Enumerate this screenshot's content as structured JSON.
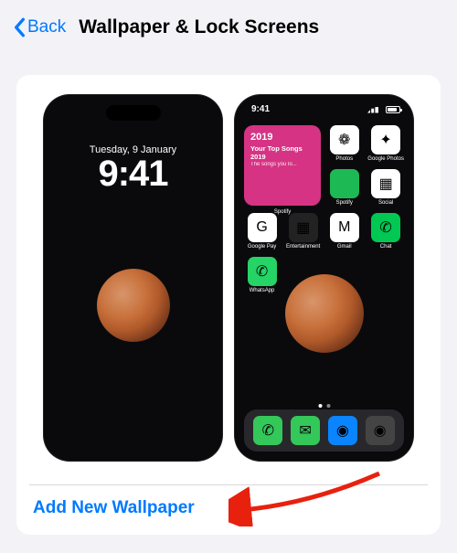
{
  "header": {
    "back_label": "Back",
    "title": "Wallpaper & Lock Screens"
  },
  "lock_screen": {
    "date": "Tuesday, 9 January",
    "time": "9:41"
  },
  "home_screen": {
    "time": "9:41",
    "widget": {
      "year": "2019",
      "title": "Your Top Songs 2019",
      "subtitle": "The songs you lo...",
      "app": "Spotify"
    },
    "apps": [
      {
        "label": "Photos",
        "icon": "photos-icon",
        "cls": "ic-photos",
        "glyph": "❁"
      },
      {
        "label": "Google Photos",
        "icon": "google-photos-icon",
        "cls": "ic-gphotos",
        "glyph": "✦"
      },
      {
        "label": "Spotify",
        "icon": "spotify-icon",
        "cls": "ic-spotify",
        "glyph": ""
      },
      {
        "label": "Social",
        "icon": "social-folder-icon",
        "cls": "ic-social",
        "glyph": "▦"
      },
      {
        "label": "Google Pay",
        "icon": "google-pay-icon",
        "cls": "ic-gpay",
        "glyph": "G"
      },
      {
        "label": "Entertainment",
        "icon": "entertainment-folder-icon",
        "cls": "ic-ent",
        "glyph": "▦"
      },
      {
        "label": "Gmail",
        "icon": "gmail-icon",
        "cls": "ic-gmail",
        "glyph": "M"
      },
      {
        "label": "Chat",
        "icon": "chat-icon",
        "cls": "ic-chat",
        "glyph": "✆"
      },
      {
        "label": "WhatsApp",
        "icon": "whatsapp-icon",
        "cls": "ic-wa",
        "glyph": "✆"
      }
    ],
    "dock": [
      {
        "icon": "phone-icon",
        "cls": "ic-phone",
        "glyph": "✆"
      },
      {
        "icon": "messages-icon",
        "cls": "ic-msg",
        "glyph": "✉"
      },
      {
        "icon": "safari-icon",
        "cls": "ic-safari",
        "glyph": "◉"
      },
      {
        "icon": "camera-icon",
        "cls": "ic-cam",
        "glyph": "◉"
      }
    ]
  },
  "actions": {
    "add_new": "Add New Wallpaper"
  },
  "colors": {
    "accent": "#007aff",
    "widget_bg": "#d63384"
  }
}
